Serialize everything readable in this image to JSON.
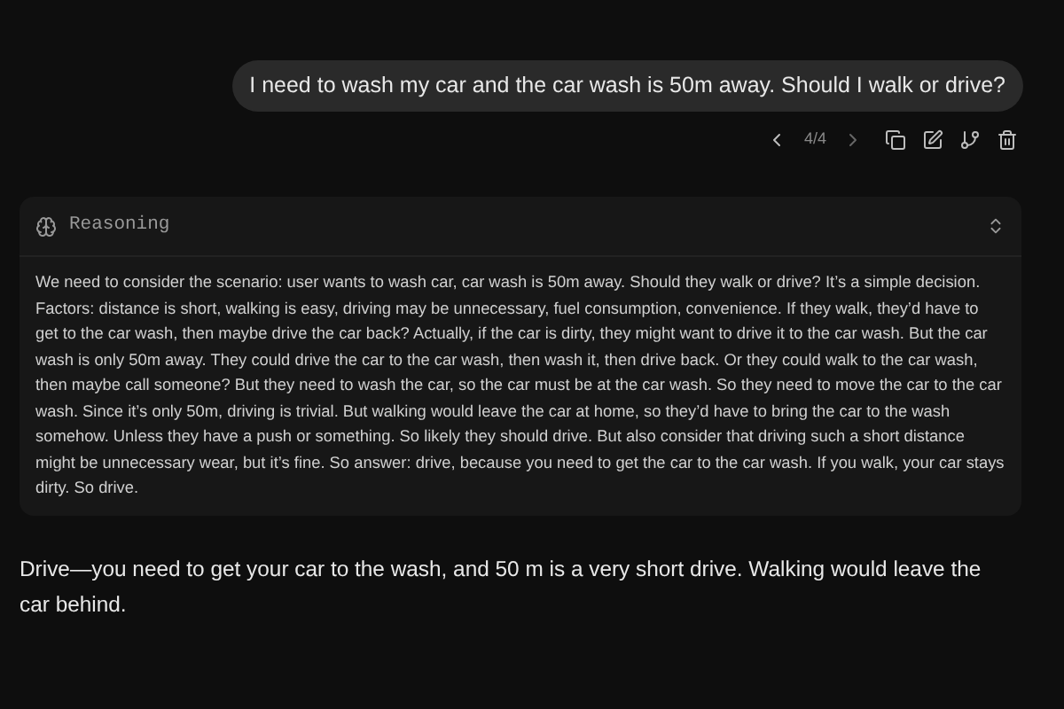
{
  "user_message": {
    "text": "I need to wash my car and the car wash is 50m away. Should I walk or drive?",
    "pager": "4/4"
  },
  "reasoning": {
    "title": "Reasoning",
    "expanded": true,
    "text": "We need to consider the scenario: user wants to wash car, car wash is 50m away. Should they walk or drive? It’s a simple decision. Factors: distance is short, walking is easy, driving may be unnecessary, fuel consumption, convenience. If they walk, they’d have to get to the car wash, then maybe drive the car back? Actually, if the car is dirty, they might want to drive it to the car wash. But the car wash is only 50m away. They could drive the car to the car wash, then wash it, then drive back. Or they could walk to the car wash, then maybe call someone? But they need to wash the car, so the car must be at the car wash. So they need to move the car to the car wash. Since it’s only 50m, driving is trivial. But walking would leave the car at home, so they’d have to bring the car to the wash somehow. Unless they have a push or something. So likely they should drive. But also consider that driving such a short distance might be unnecessary wear, but it’s fine. So answer: drive, because you need to get the car to the car wash. If you walk, your car stays dirty. So drive."
  },
  "answer": "Drive—you need to get your car to the wash, and 50 m is a very short drive. Walking would leave the car behind."
}
